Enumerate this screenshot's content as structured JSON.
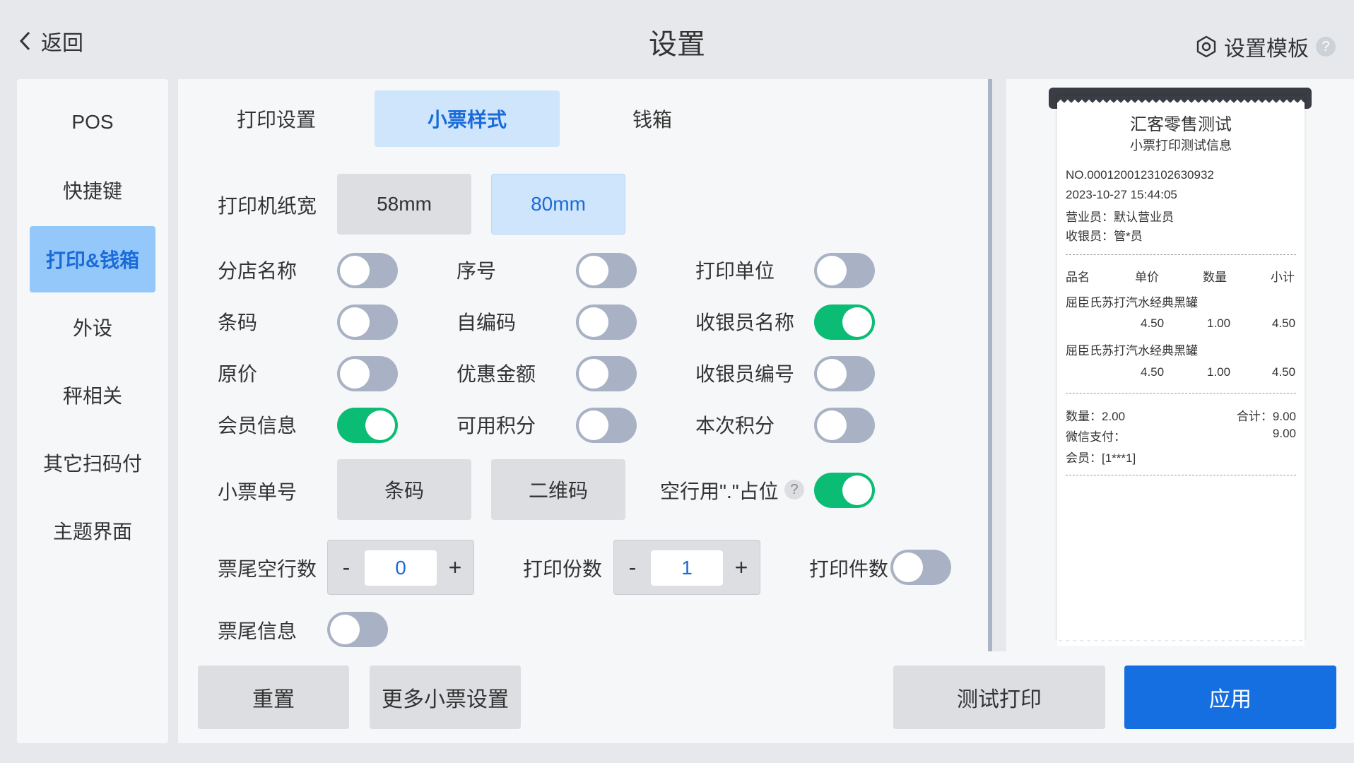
{
  "header": {
    "back_label": "返回",
    "title": "设置",
    "template_label": "设置模板",
    "help": "?"
  },
  "sidebar": {
    "items": [
      {
        "label": "POS"
      },
      {
        "label": "快捷键"
      },
      {
        "label": "打印&钱箱"
      },
      {
        "label": "外设"
      },
      {
        "label": "秤相关"
      },
      {
        "label": "其它扫码付"
      },
      {
        "label": "主题界面"
      }
    ],
    "active_index": 2
  },
  "tabs": {
    "items": [
      {
        "label": "打印设置"
      },
      {
        "label": "小票样式"
      },
      {
        "label": "钱箱"
      }
    ],
    "active_index": 1
  },
  "settings": {
    "paper_width": {
      "label": "打印机纸宽",
      "options": [
        "58mm",
        "80mm"
      ],
      "selected": "80mm"
    },
    "toggles": {
      "store_name": {
        "label": "分店名称",
        "on": false
      },
      "serial": {
        "label": "序号",
        "on": false
      },
      "print_unit": {
        "label": "打印单位",
        "on": false
      },
      "barcode": {
        "label": "条码",
        "on": false
      },
      "self_code": {
        "label": "自编码",
        "on": false
      },
      "cashier_name": {
        "label": "收银员名称",
        "on": true
      },
      "original_price": {
        "label": "原价",
        "on": false
      },
      "discount_amount": {
        "label": "优惠金额",
        "on": false
      },
      "cashier_id": {
        "label": "收银员编号",
        "on": false
      },
      "member_info": {
        "label": "会员信息",
        "on": true
      },
      "available_points": {
        "label": "可用积分",
        "on": false
      },
      "current_points": {
        "label": "本次积分",
        "on": false
      },
      "blank_line_placeholder": {
        "label": "空行用\".\"占位",
        "on": true
      },
      "print_item_count": {
        "label": "打印件数",
        "on": false
      },
      "footer_info": {
        "label": "票尾信息",
        "on": false
      }
    },
    "ticket_number": {
      "label": "小票单号",
      "options": [
        "条码",
        "二维码"
      ]
    },
    "footer_blank_lines": {
      "label": "票尾空行数",
      "value": "0"
    },
    "print_copies": {
      "label": "打印份数",
      "value": "1"
    },
    "minus": "-",
    "plus": "+",
    "help": "?"
  },
  "footer": {
    "reset": "重置",
    "more": "更多小票设置",
    "test_print": "测试打印",
    "apply": "应用"
  },
  "receipt": {
    "title": "汇客零售测试",
    "subtitle": "小票打印测试信息",
    "no": "NO.0001200123102630932",
    "datetime": "2023-10-27 15:44:05",
    "salesperson": "营业员：默认营业员",
    "cashier": "收银员：管*员",
    "columns": [
      "品名",
      "单价",
      "数量",
      "小计"
    ],
    "items": [
      {
        "name": "屈臣氏苏打汽水经典黑罐",
        "price": "4.50",
        "qty": "1.00",
        "subtotal": "4.50"
      },
      {
        "name": "屈臣氏苏打汽水经典黑罐",
        "price": "4.50",
        "qty": "1.00",
        "subtotal": "4.50"
      }
    ],
    "qty_total": "数量：2.00",
    "total": "合计：9.00",
    "wechat_label": "微信支付：",
    "wechat_value": "9.00",
    "member": "会员：[1***1]"
  },
  "colors": {
    "accent": "#156fe0",
    "toggle_on": "#0bbd74",
    "toggle_off": "#a9b2c4",
    "selected_bg": "#cfe5fc"
  }
}
